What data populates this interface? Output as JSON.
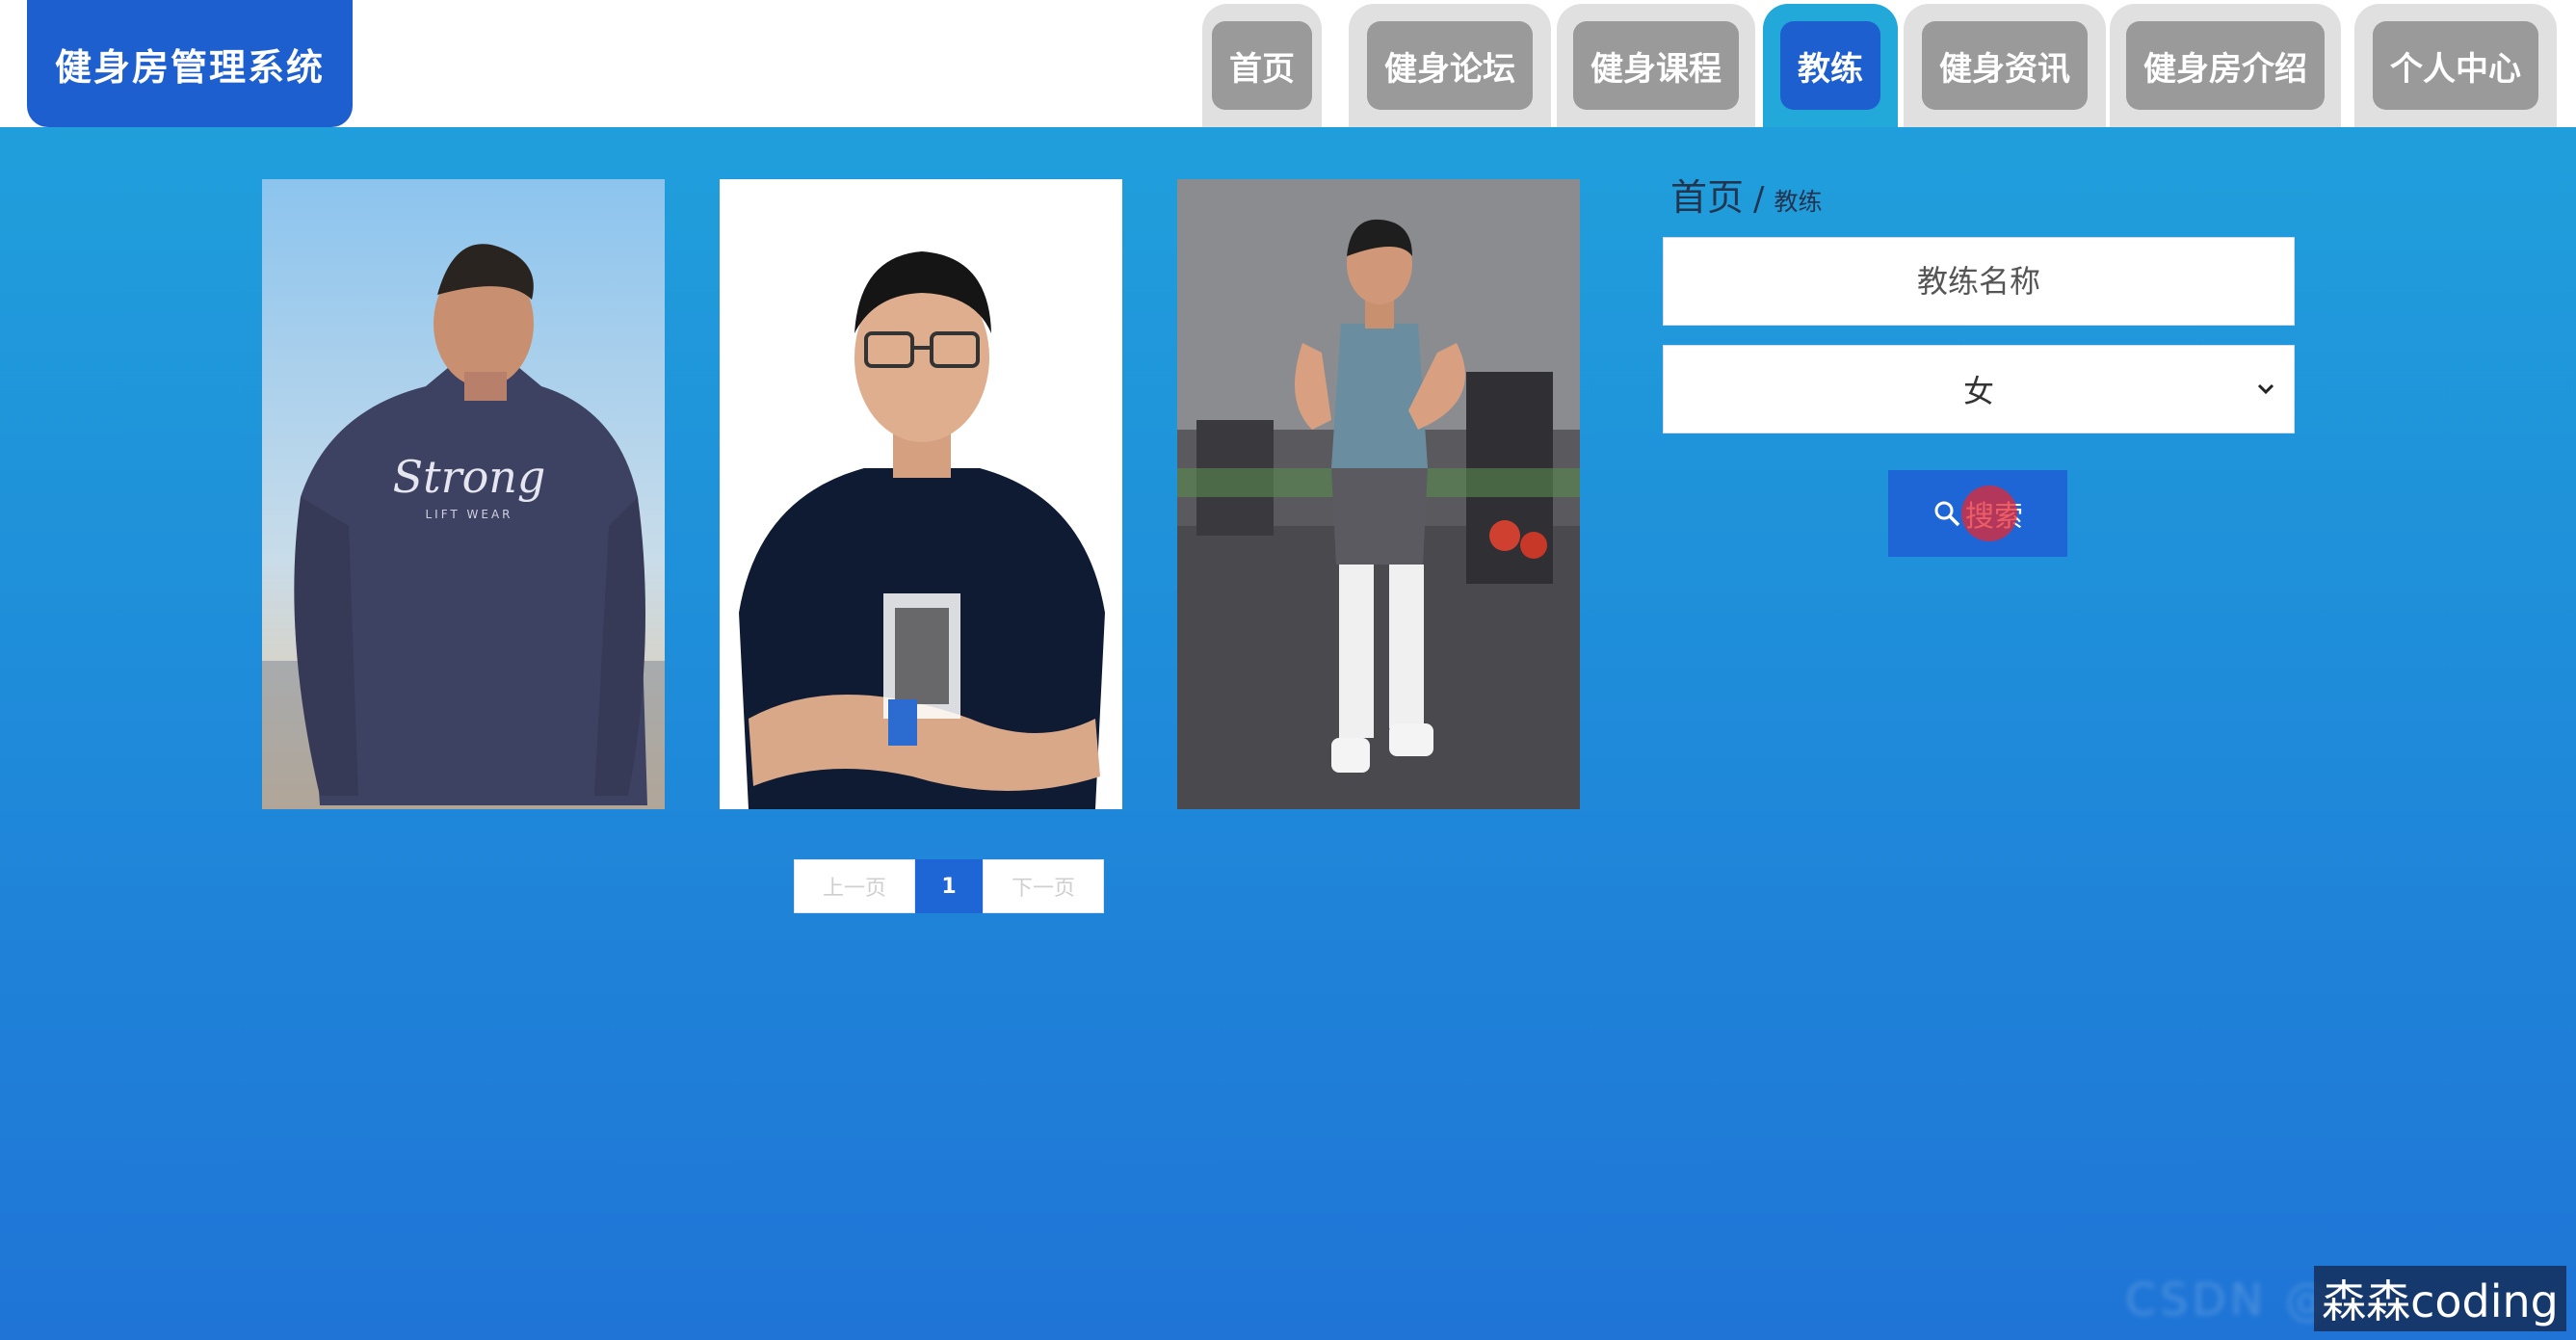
{
  "header": {
    "brand": "健身房管理系统",
    "nav": [
      {
        "label": "首页",
        "active": false
      },
      {
        "label": "健身论坛",
        "active": false
      },
      {
        "label": "健身课程",
        "active": false
      },
      {
        "label": "教练",
        "active": true
      },
      {
        "label": "健身资讯",
        "active": false
      },
      {
        "label": "健身房介绍",
        "active": false
      },
      {
        "label": "个人中心",
        "active": false
      }
    ]
  },
  "coaches": [
    {
      "photo_label": "Strong",
      "photo_sub": "LIFT WEAR"
    },
    {
      "photo_label": "",
      "photo_sub": ""
    },
    {
      "photo_label": "",
      "photo_sub": ""
    }
  ],
  "pagination": {
    "prev": "上一页",
    "current": "1",
    "next": "下一页"
  },
  "breadcrumb": {
    "home": "首页",
    "separator": "/",
    "current": "教练"
  },
  "search": {
    "name_placeholder": "教练名称",
    "gender_value": "女",
    "button_label": "搜索"
  },
  "watermark": {
    "blurred": "CSDN @",
    "label": "森森coding"
  },
  "colors": {
    "accent": "#1e5fd0",
    "inactive_tab": "#9a9a9a",
    "background": "#1f8fda"
  }
}
